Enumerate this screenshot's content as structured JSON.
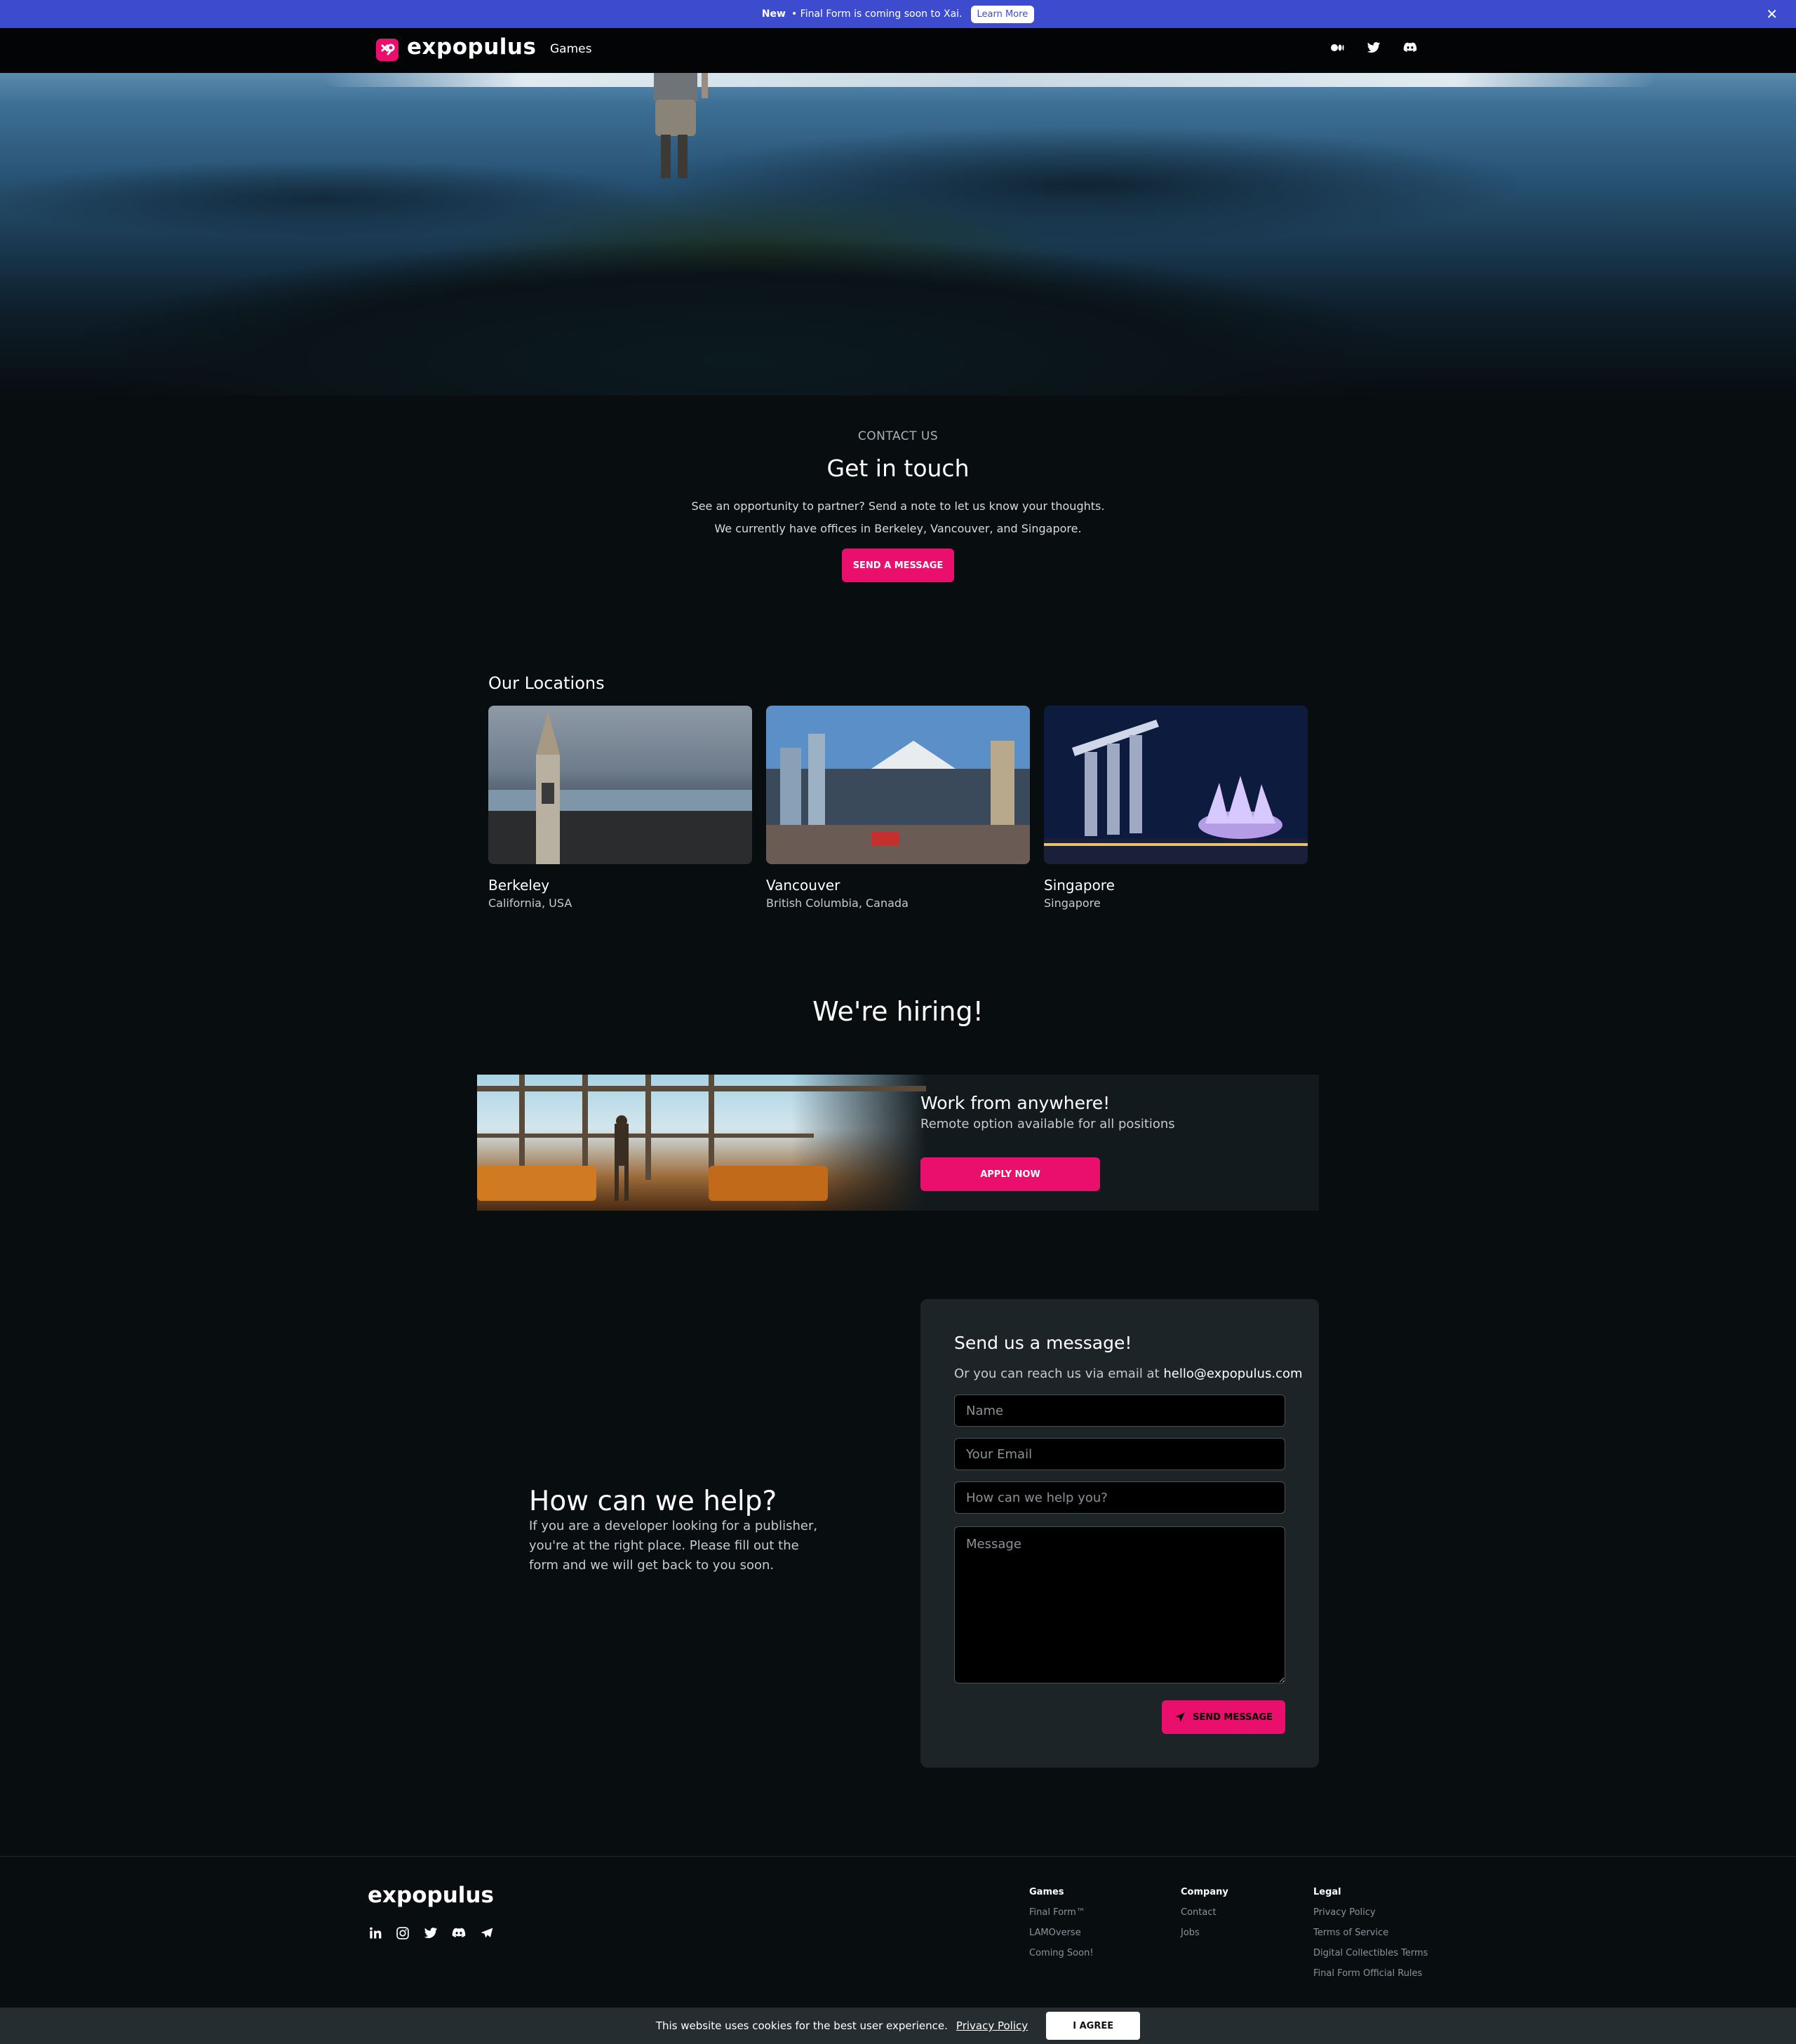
{
  "announcement": {
    "new_label": "New",
    "text": "• Final Form is coming soon to Xai.",
    "learn_more": "Learn More",
    "close_icon": "close-icon"
  },
  "nav": {
    "brand": "expopulus",
    "games": "Games",
    "icons": [
      "medium-icon",
      "twitter-icon",
      "discord-icon"
    ]
  },
  "contact": {
    "eyebrow": "CONTACT US",
    "title": "Get in touch",
    "line1": "See an opportunity to partner? Send a note to let us know your thoughts.",
    "line2": "We currently have offices in Berkeley, Vancouver, and Singapore.",
    "button": "SEND A MESSAGE"
  },
  "locations": {
    "title": "Our Locations",
    "items": [
      {
        "name": "Berkeley",
        "region": "California, USA"
      },
      {
        "name": "Vancouver",
        "region": "British Columbia, Canada"
      },
      {
        "name": "Singapore",
        "region": "Singapore"
      }
    ]
  },
  "hiring": {
    "title": "We're hiring!",
    "card_title": "Work from anywhere!",
    "card_sub": "Remote option available for all positions",
    "button": "APPLY NOW"
  },
  "help": {
    "title": "How can we help?",
    "text": "If you are a developer looking for a publisher, you're at the right place. Please fill out the form and we will get back to you soon."
  },
  "form": {
    "title": "Send us a message!",
    "sub": "Or you can reach us via email at",
    "email": "hello@expopulus.com",
    "name_ph": "Name",
    "email_ph": "Your Email",
    "help_ph": "How can we help you?",
    "message_ph": "Message",
    "button": "SEND MESSAGE"
  },
  "footer": {
    "brand": "expopulus",
    "social": [
      "linkedin-icon",
      "instagram-icon",
      "twitter-icon",
      "discord-icon",
      "telegram-icon"
    ],
    "games": {
      "heading": "Games",
      "links": [
        "Final Form™",
        "LAMOverse",
        "Coming Soon!"
      ]
    },
    "company": {
      "heading": "Company",
      "links": [
        "Contact",
        "Jobs"
      ]
    },
    "legal": {
      "heading": "Legal",
      "links": [
        "Privacy Policy",
        "Terms of Service",
        "Digital Collectibles Terms",
        "Final Form Official Rules"
      ]
    }
  },
  "cookie": {
    "text": "This website uses cookies for the best user experience.",
    "policy": "Privacy Policy",
    "agree": "I AGREE"
  },
  "colors": {
    "accent": "#ea0e6d",
    "banner": "#3d4ccf",
    "background": "#080d10"
  }
}
